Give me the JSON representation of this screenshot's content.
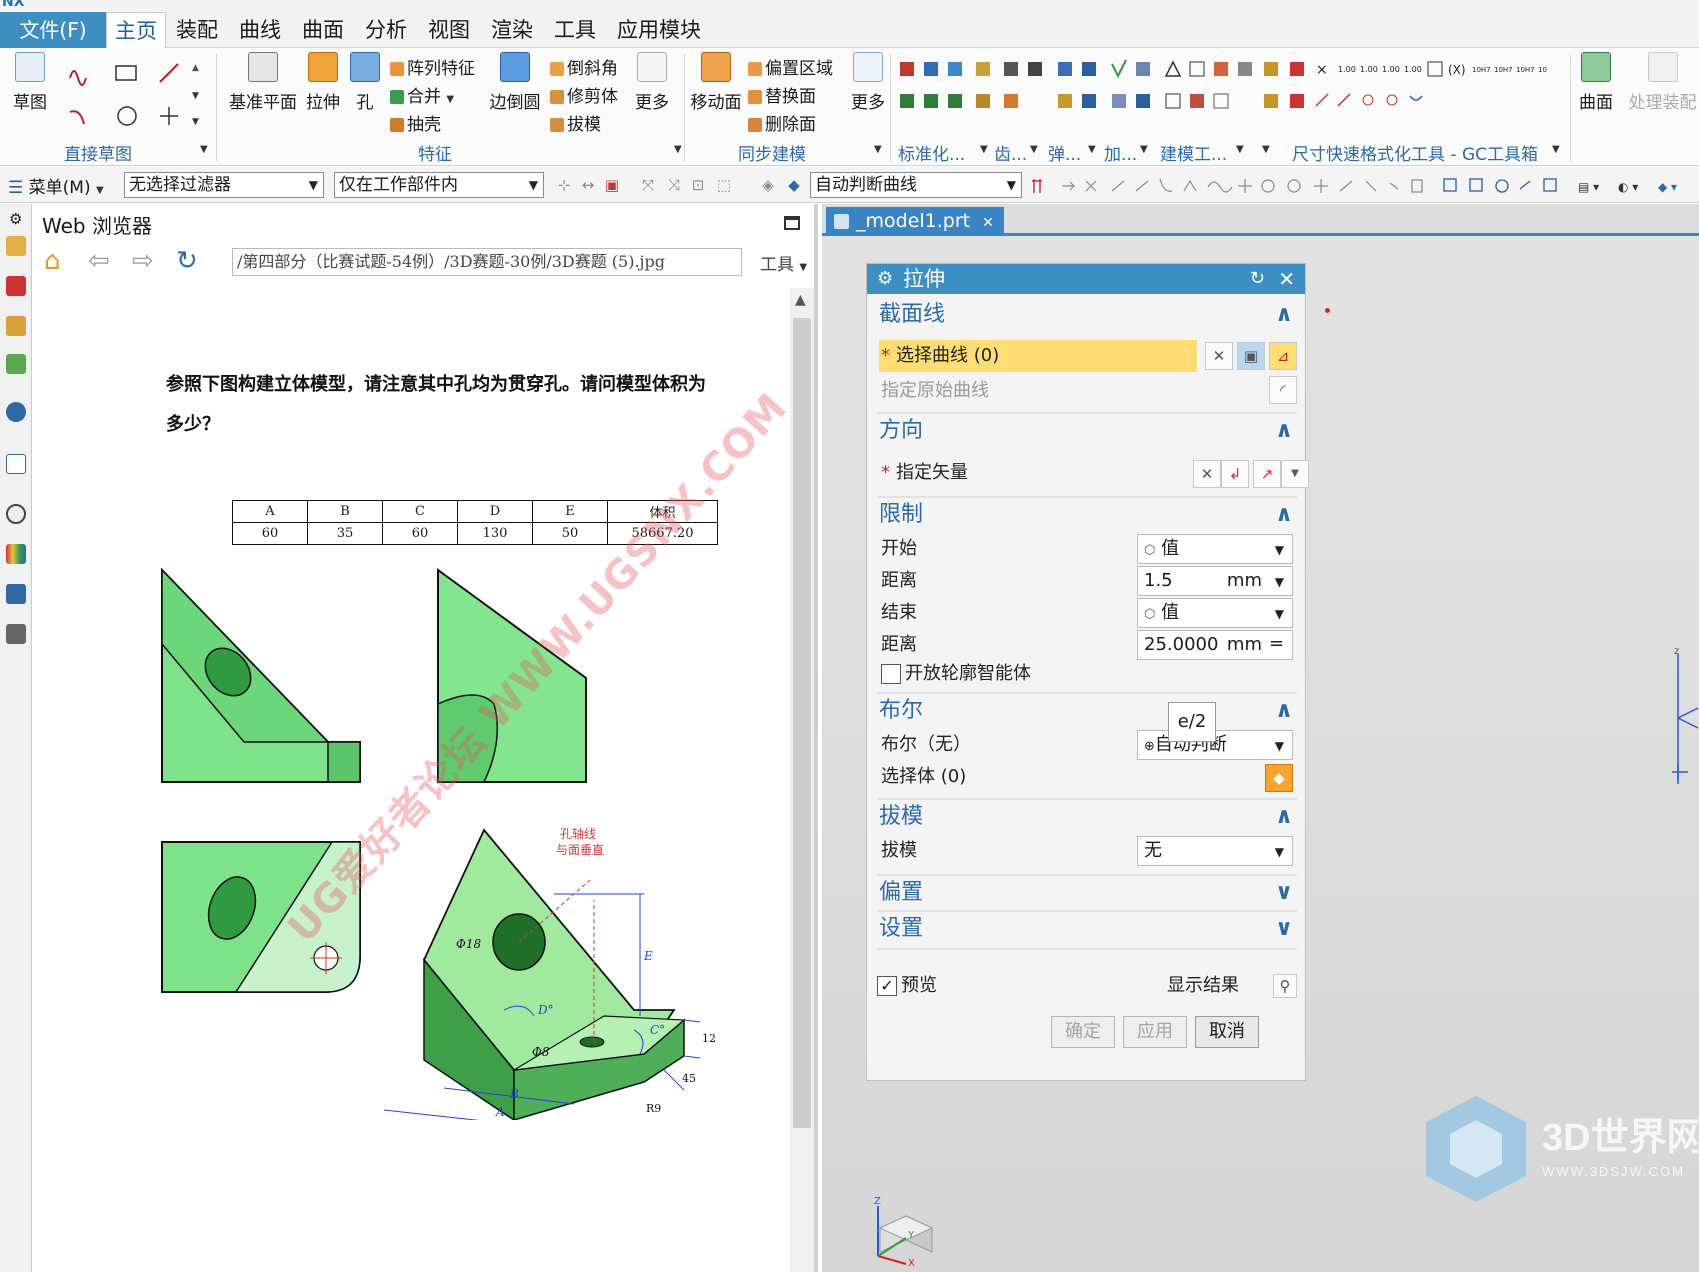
{
  "app": {
    "name": "NX"
  },
  "menu": {
    "file": "文件(F)",
    "tabs": [
      "主页",
      "装配",
      "曲线",
      "曲面",
      "分析",
      "视图",
      "渲染",
      "工具",
      "应用模块"
    ]
  },
  "ribbon": {
    "direct_sketch": {
      "sketch": "草图",
      "label": "直接草图"
    },
    "feature": {
      "datum_plane": "基准平面",
      "extrude": "拉伸",
      "hole": "孔",
      "pattern": "阵列特征",
      "unite": "合并",
      "shell": "抽壳",
      "blend": "边倒圆",
      "chamfer": "倒斜角",
      "trim": "修剪体",
      "draft": "拔模",
      "more": "更多",
      "label": "特征"
    },
    "sync": {
      "move_face": "移动面",
      "offset_region": "偏置区域",
      "replace_face": "替换面",
      "delete_face": "删除面",
      "more": "更多",
      "label": "同步建模"
    },
    "groups": [
      "标准化...",
      "齿...",
      "弹...",
      "加...",
      "建模工..."
    ],
    "gc_label": "尺寸快速格式化工具 - GC工具箱",
    "surface": "曲面",
    "process_assembly": "处理装配"
  },
  "filterbar": {
    "menu": "菜单(M)",
    "type_filter": "无选择过滤器",
    "scope": "仅在工作部件内",
    "curve_rule": "自动判断曲线"
  },
  "browser": {
    "title": "Web 浏览器",
    "url": "/第四部分（比赛试题-54例）/3D赛题-30例/3D赛题 (5).jpg",
    "tools": "工具",
    "question_line1": "参照下图构建立体模型，请注意其中孔均为贯穿孔。请问模型体积为",
    "question_line2": "多少？",
    "table": {
      "headers": [
        "A",
        "B",
        "C",
        "D",
        "E",
        "体积"
      ],
      "values": [
        "60",
        "35",
        "60",
        "130",
        "50",
        "58667.20"
      ]
    },
    "annotations": {
      "hole_axis_1": "孔轴线",
      "hole_axis_2": "与面垂直",
      "phi18": "Φ18",
      "phi8": "Φ8",
      "dim_D": "D°",
      "dim_C": "C°",
      "dim_E": "E",
      "dim_A": "A",
      "dim_B": "B",
      "dim_12": "12",
      "dim_45": "45",
      "dim_R9": "R9"
    },
    "watermark": "UG爱好者论坛 WWW.UGSNX.COM"
  },
  "viewport": {
    "tab": "_model1.prt"
  },
  "dialog": {
    "title": "拉伸",
    "section": {
      "header": "截面线",
      "select_curve": "选择曲线 (0)",
      "specify_origin": "指定原始曲线"
    },
    "direction": {
      "header": "方向",
      "specify_vector": "指定矢量"
    },
    "limits": {
      "header": "限制",
      "start_label": "开始",
      "start_value": "值",
      "start_dist_label": "距离",
      "start_dist": "1.5",
      "unit": "mm",
      "end_label": "结束",
      "end_value": "值",
      "end_dist_label": "距离",
      "end_dist": "25.0000",
      "open_profile": "开放轮廓智能体",
      "tooltip": "e/2"
    },
    "boolean": {
      "header": "布尔",
      "label": "布尔（无）",
      "value": "自动判断",
      "select_body": "选择体 (0)"
    },
    "draft": {
      "header": "拔模",
      "label": "拔模",
      "value": "无"
    },
    "offset": {
      "header": "偏置"
    },
    "settings": {
      "header": "设置"
    },
    "preview": "预览",
    "show_result": "显示结果",
    "buttons": {
      "ok": "确定",
      "apply": "应用",
      "cancel": "取消"
    }
  },
  "logo": {
    "main": "3D世界网",
    "sub": "WWW.3DSJW.COM"
  },
  "colors": {
    "accent": "#3d8fc4",
    "highlight": "#ffdd75",
    "model_green": "#7fe08a"
  }
}
